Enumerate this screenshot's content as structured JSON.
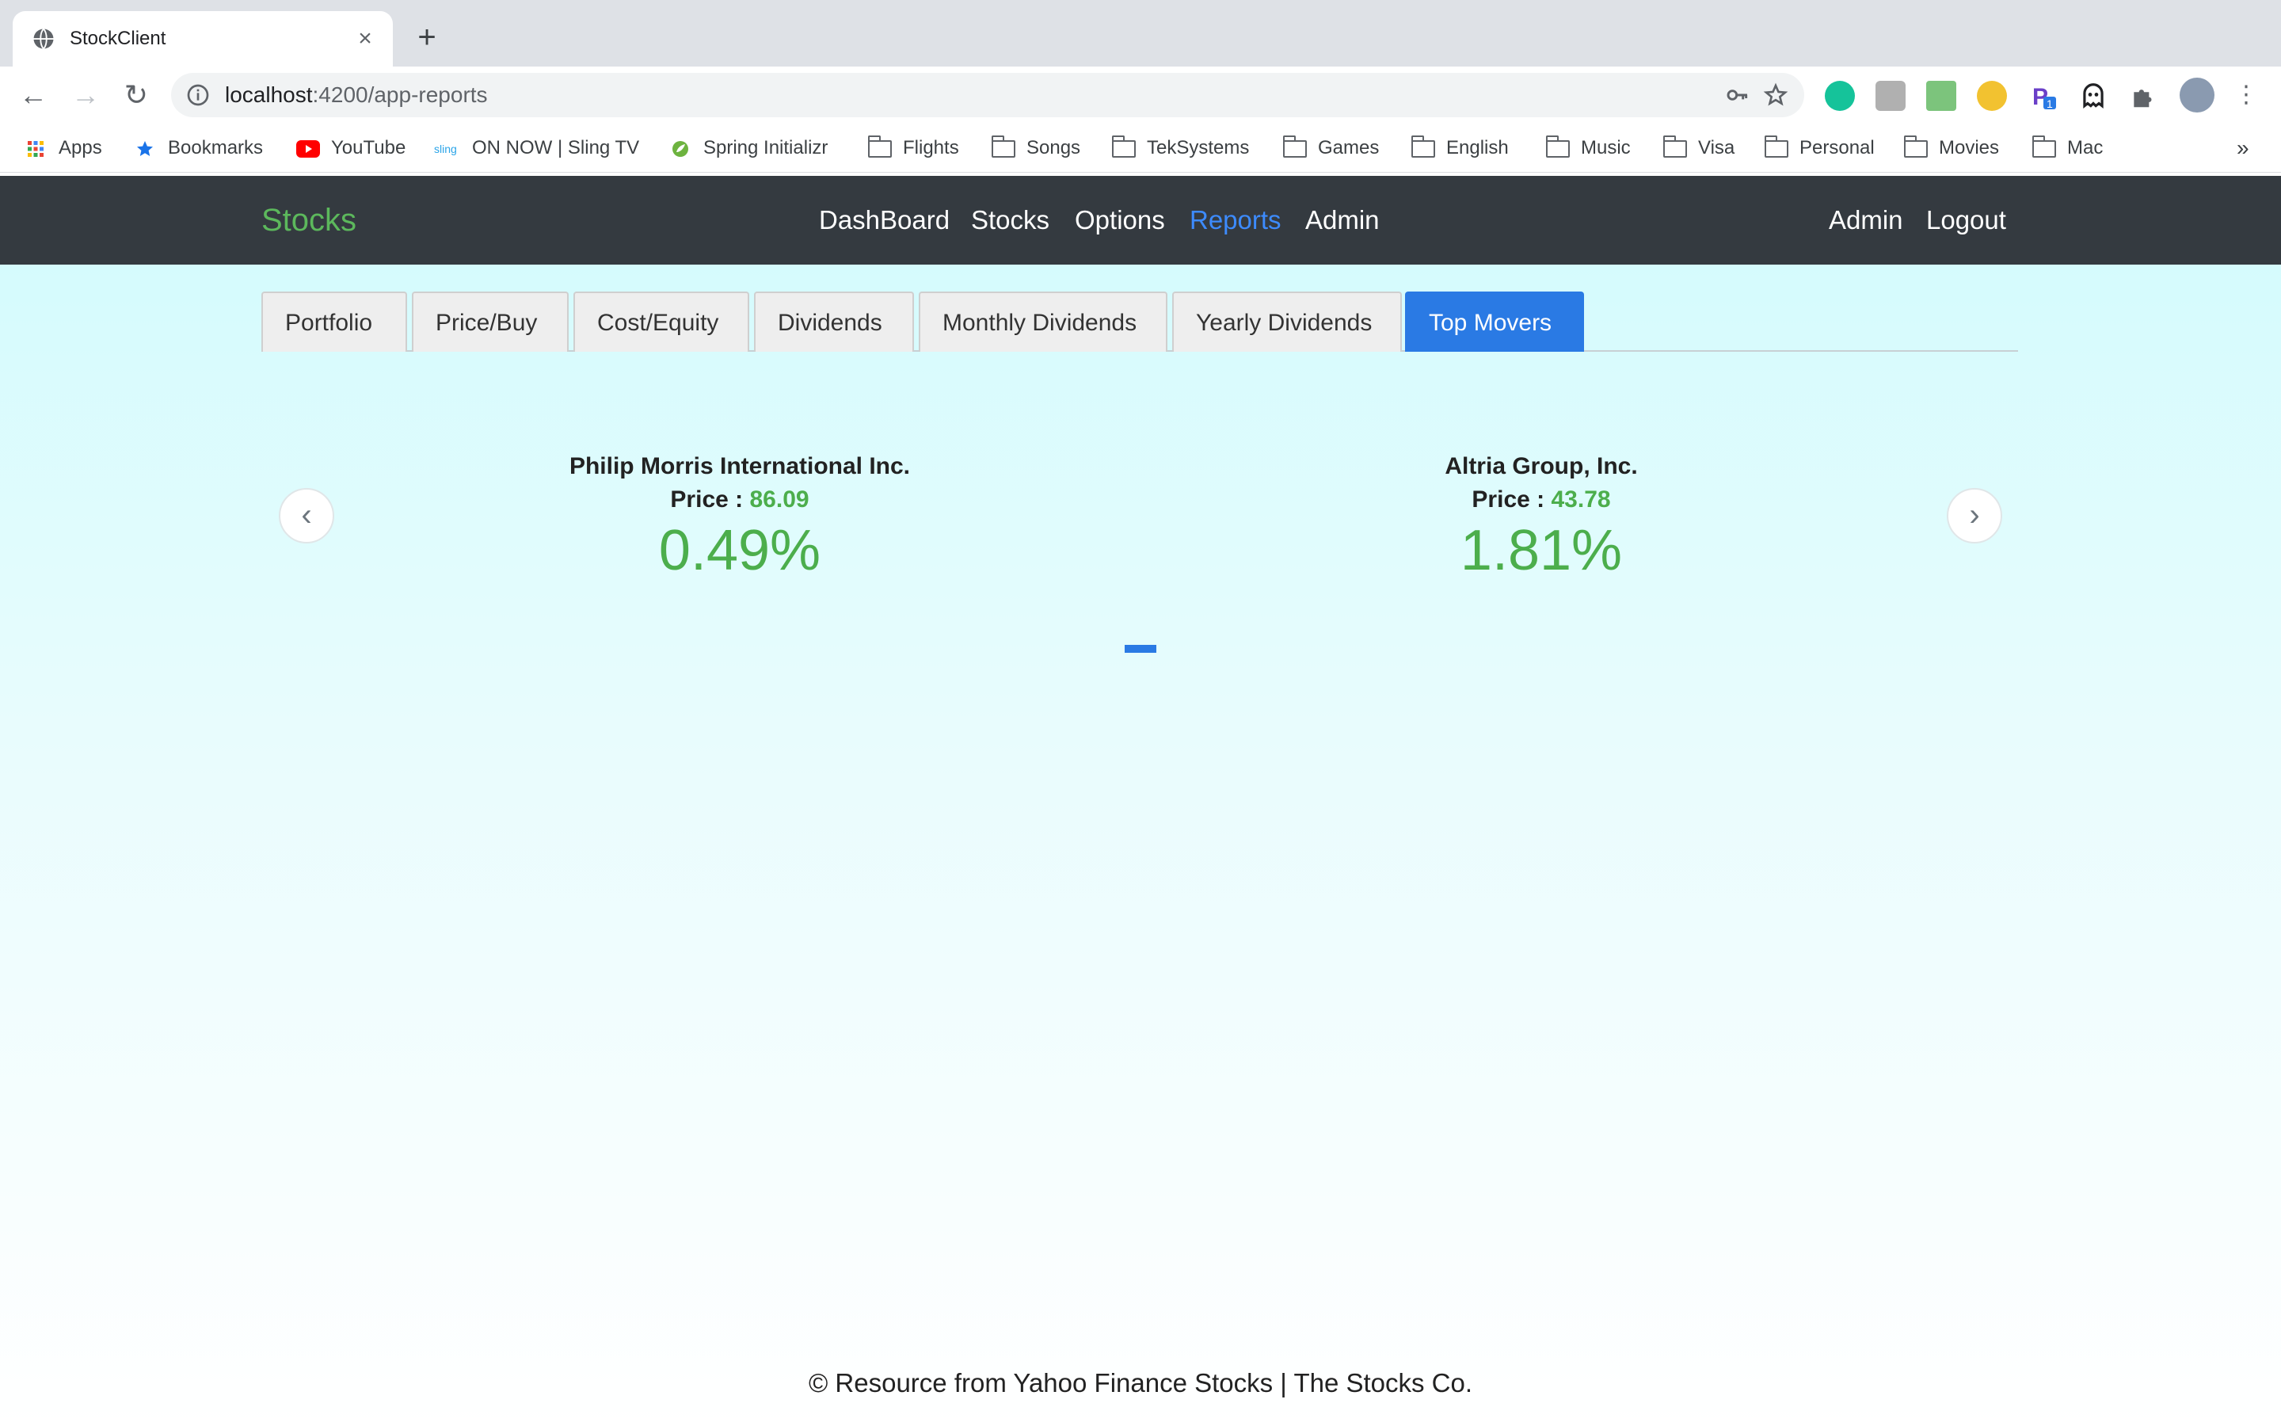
{
  "browser": {
    "tab_title": "StockClient",
    "url_host": "localhost",
    "url_path": ":4200/app-reports",
    "bookmarks": [
      {
        "label": "Apps",
        "icon": "apps-grid-icon"
      },
      {
        "label": "Bookmarks",
        "icon": "star-icon"
      },
      {
        "label": "YouTube",
        "icon": "youtube-icon"
      },
      {
        "label": "ON NOW | Sling TV",
        "icon": "sling-icon"
      },
      {
        "label": "Spring Initializr",
        "icon": "spring-icon"
      },
      {
        "label": "Flights",
        "icon": "folder-icon"
      },
      {
        "label": "Songs",
        "icon": "folder-icon"
      },
      {
        "label": "TekSystems",
        "icon": "folder-icon"
      },
      {
        "label": "Games",
        "icon": "folder-icon"
      },
      {
        "label": "English",
        "icon": "folder-icon"
      },
      {
        "label": "Music",
        "icon": "folder-icon"
      },
      {
        "label": "Visa",
        "icon": "folder-icon"
      },
      {
        "label": "Personal",
        "icon": "folder-icon"
      },
      {
        "label": "Movies",
        "icon": "folder-icon"
      },
      {
        "label": "Mac",
        "icon": "folder-icon"
      }
    ],
    "overflow_label": "»",
    "sling_prefix": "sling",
    "extension_badge": "1"
  },
  "navbar": {
    "brand": "Stocks",
    "links": [
      "DashBoard",
      "Stocks",
      "Options",
      "Reports",
      "Admin"
    ],
    "active_link": "Reports",
    "right_links": [
      "Admin",
      "Logout"
    ]
  },
  "report_tabs": {
    "items": [
      "Portfolio",
      "Price/Buy",
      "Cost/Equity",
      "Dividends",
      "Monthly Dividends",
      "Yearly Dividends",
      "Top Movers"
    ],
    "active": "Top Movers"
  },
  "carousel": {
    "price_label": "Price :",
    "cards": [
      {
        "name": "Philip Morris International Inc.",
        "price": "86.09",
        "change": "0.49%"
      },
      {
        "name": "Altria Group, Inc.",
        "price": "43.78",
        "change": "1.81%"
      }
    ]
  },
  "colors": {
    "navbar_bg": "#343a40",
    "brand_green": "#5cb85c",
    "active_blue": "#2a7ae4",
    "gain_green": "#4cae4c"
  },
  "footer": {
    "text": "© Resource from Yahoo Finance Stocks | The Stocks Co."
  }
}
